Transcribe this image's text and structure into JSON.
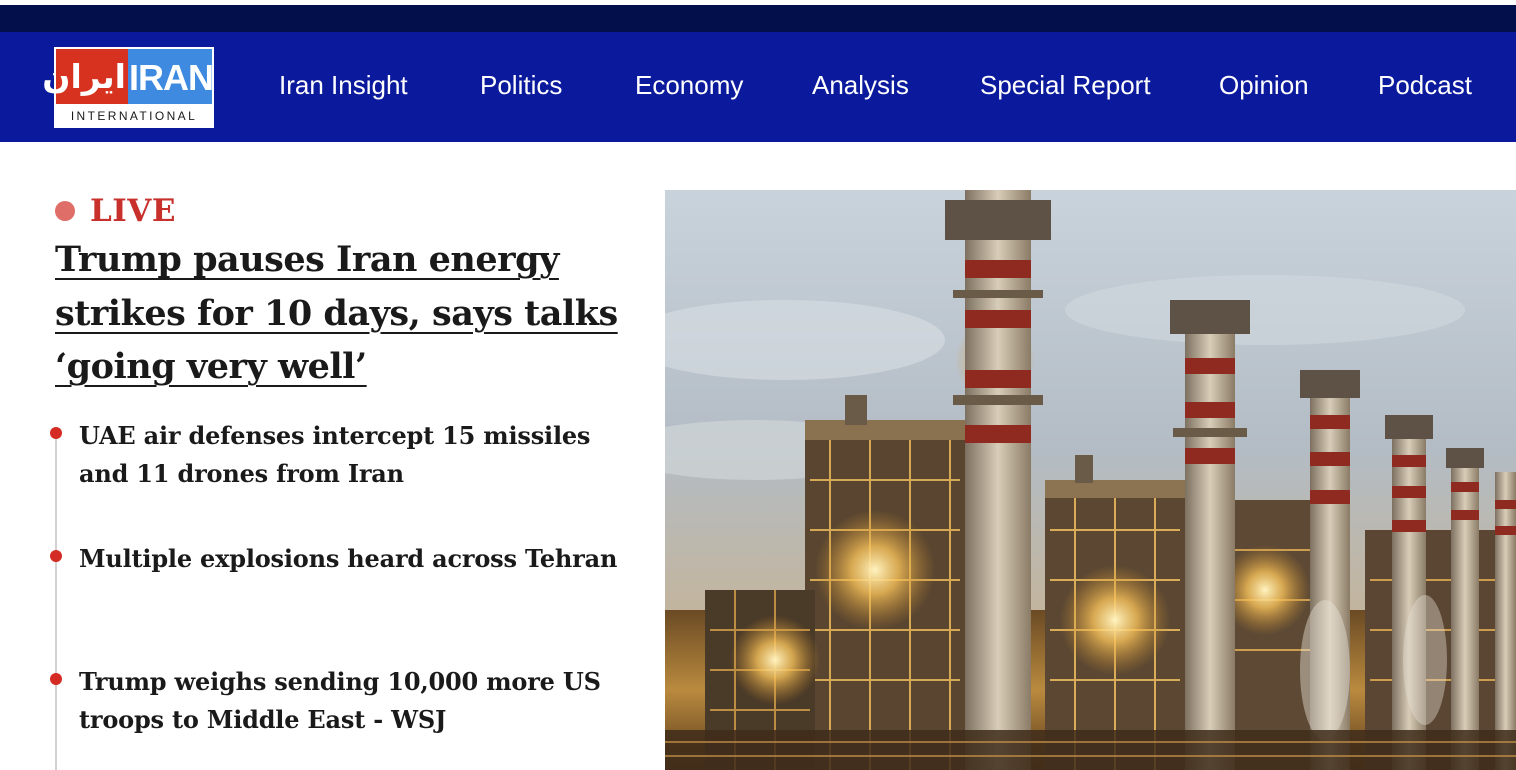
{
  "header": {
    "logo": {
      "persian_text": "ایران",
      "latin_text": "IRAN",
      "subtitle": "INTERNATIONAL"
    },
    "nav_items": [
      {
        "label": "Iran Insight"
      },
      {
        "label": "Politics"
      },
      {
        "label": "Economy"
      },
      {
        "label": "Analysis"
      },
      {
        "label": "Special Report"
      },
      {
        "label": "Opinion"
      },
      {
        "label": "Podcast"
      }
    ]
  },
  "main": {
    "live_label": "LIVE",
    "headline": "Trump pauses Iran energy strikes for 10 days, says talks ‘going very well’",
    "updates": [
      {
        "text": "UAE air defenses intercept 15 missiles and 11 drones from Iran"
      },
      {
        "text": "Multiple explosions heard across Tehran"
      },
      {
        "text": "Trump weighs sending 10,000 more US troops to Middle East - WSJ"
      }
    ]
  },
  "colors": {
    "top_bar": "#020f4a",
    "nav_bar": "#0b1a9c",
    "logo_red": "#d6321f",
    "logo_blue": "#3d8ae0",
    "live_red": "#c8302c",
    "live_dot": "#df6d68",
    "bullet_red": "#d42b24",
    "text_dark": "#1a1a1a"
  }
}
